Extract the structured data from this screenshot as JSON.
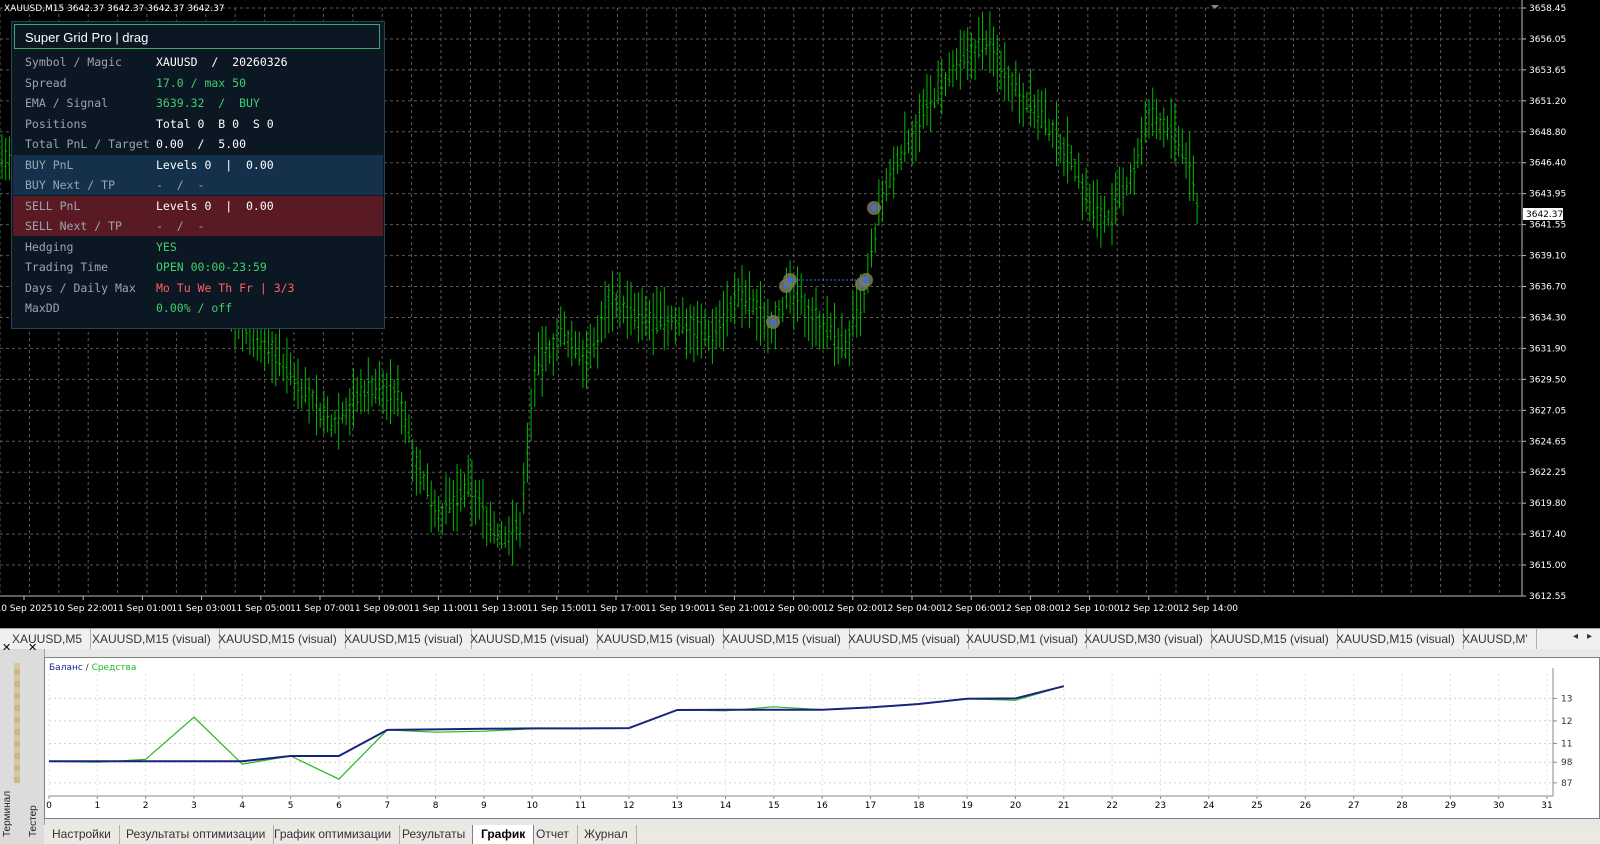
{
  "chart": {
    "header_text": "XAUUSD,M15  3642.37 3642.37 3642.37 3642.37",
    "price_labels": [
      "3658.45",
      "3656.05",
      "3653.65",
      "3651.20",
      "3648.80",
      "3646.40",
      "3643.95",
      "3641.55",
      "3639.10",
      "3636.70",
      "3634.30",
      "3631.90",
      "3629.50",
      "3627.05",
      "3624.65",
      "3622.25",
      "3619.80",
      "3617.40",
      "3615.00",
      "3612.55"
    ],
    "current_price": "3642.37",
    "time_labels": [
      "10 Sep 2025",
      "10 Sep 22:00",
      "11 Sep 01:00",
      "11 Sep 03:00",
      "11 Sep 05:00",
      "11 Sep 07:00",
      "11 Sep 09:00",
      "11 Sep 11:00",
      "11 Sep 13:00",
      "11 Sep 15:00",
      "11 Sep 17:00",
      "11 Sep 19:00",
      "11 Sep 21:00",
      "12 Sep 00:00",
      "12 Sep 02:00",
      "12 Sep 04:00",
      "12 Sep 06:00",
      "12 Sep 08:00",
      "12 Sep 10:00",
      "12 Sep 12:00",
      "12 Sep 14:00"
    ],
    "candle_color": "#00b800",
    "grid_color": "#5a5a5a"
  },
  "panel": {
    "title": "Super Grid Pro  |  drag",
    "rows": [
      {
        "label": "Symbol / Magic",
        "value": "XAUUSD  /  20260326",
        "color": "#ffffff",
        "bg": ""
      },
      {
        "label": "Spread",
        "value": "17.0 / max 50",
        "color": "#3ecf6a",
        "bg": ""
      },
      {
        "label": "EMA / Signal",
        "value": "3639.32  /  BUY",
        "color": "#3ecf6a",
        "bg": ""
      },
      {
        "label": "Positions",
        "value": "Total 0  B 0  S 0",
        "color": "#ffffff",
        "bg": ""
      },
      {
        "label": "Total PnL / Target",
        "value": "0.00  /  5.00",
        "color": "#ffffff",
        "bg": ""
      },
      {
        "label": "BUY PnL",
        "value": "Levels 0  |  0.00",
        "color": "#ffffff",
        "bg": "#14304a"
      },
      {
        "label": "BUY Next / TP",
        "value": "-  /  -",
        "color": "#9aa5b1",
        "bg": "#14304a"
      },
      {
        "label": "SELL PnL",
        "value": "Levels 0  |  0.00",
        "color": "#ffffff",
        "bg": "#5a1a24"
      },
      {
        "label": "SELL Next / TP",
        "value": "-  /  -",
        "color": "#9aa5b1",
        "bg": "#5a1a24"
      },
      {
        "label": "Hedging",
        "value": "YES",
        "color": "#3ecf6a",
        "bg": ""
      },
      {
        "label": "Trading Time",
        "value": "OPEN 00:00-23:59",
        "color": "#3ecf6a",
        "bg": ""
      },
      {
        "label": "Days / Daily Max",
        "value": "Mo Tu We Th Fr | 3/3",
        "color": "#ff6060",
        "bg": ""
      },
      {
        "label": "MaxDD",
        "value": "0.00% / off",
        "color": "#3ecf6a",
        "bg": ""
      }
    ]
  },
  "chart_tabs": [
    "XAUUSD,M5",
    "XAUUSD,M15 (visual)",
    "XAUUSD,M15 (visual)",
    "XAUUSD,M15 (visual)",
    "XAUUSD,M15 (visual)",
    "XAUUSD,M15 (visual)",
    "XAUUSD,M15 (visual)",
    "XAUUSD,M5 (visual)",
    "XAUUSD,M1 (visual)",
    "XAUUSD,M30 (visual)",
    "XAUUSD,M15 (visual)",
    "XAUUSD,M15 (visual)",
    "XAUUSD,M'"
  ],
  "tester": {
    "side_label_terminal": "Терминал",
    "side_label_tester": "Тестер",
    "legend_balance": "Баланс",
    "legend_sep": " / ",
    "legend_equity": "Средства",
    "x_ticks": [
      "0",
      "1",
      "2",
      "3",
      "4",
      "5",
      "6",
      "7",
      "8",
      "9",
      "10",
      "11",
      "12",
      "13",
      "14",
      "15",
      "16",
      "17",
      "18",
      "19",
      "20",
      "21",
      "22",
      "23",
      "24",
      "25",
      "26",
      "27",
      "28",
      "29",
      "30",
      "31"
    ],
    "y_ticks": [
      "13",
      "12",
      "11",
      "98",
      "87"
    ],
    "balance": [
      98.5,
      98.5,
      98.5,
      98.5,
      98.5,
      101.3,
      101.3,
      115.2,
      115.5,
      115.8,
      116.0,
      116.0,
      116.2,
      125.8,
      125.9,
      126.0,
      126.0,
      127.2,
      129.0,
      131.8,
      132.0,
      138.5
    ],
    "equity": [
      98.5,
      98.0,
      99.5,
      122.0,
      97.0,
      101.3,
      89.0,
      115.2,
      114.0,
      114.5,
      115.8,
      116.0,
      116.2,
      125.8,
      125.4,
      127.5,
      126.0,
      127.2,
      129.0,
      131.8,
      131.0,
      138.5
    ],
    "tabs": [
      "Настройки",
      "Результаты оптимизации",
      "График оптимизации",
      "Результаты",
      "График",
      "Отчет",
      "Журнал"
    ],
    "active_tab": "График",
    "balance_color": "#1a237e",
    "equity_color": "#22b822"
  }
}
